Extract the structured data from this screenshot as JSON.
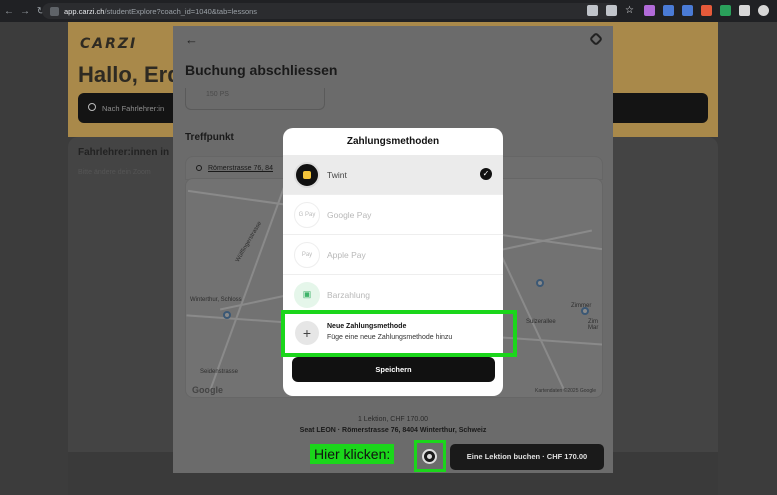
{
  "browser": {
    "back_icon": "arrow-left-icon",
    "forward_icon": "arrow-right-icon",
    "reload_icon": "reload-icon",
    "url_host": "app.carzi.ch",
    "url_path": "/studentExplore?coach_id=1040&tab=lessons",
    "extensions": [
      "#c0c4ca",
      "#c0c4ca",
      "#e8eaed",
      "#b26bd9",
      "#4a7bd6",
      "#4a7bd6",
      "#e65a3a",
      "#2aa15b",
      "#d7d7d7",
      "#d7d7d7"
    ]
  },
  "page": {
    "logo": "CARZI",
    "greeting": "Hallo, Erd",
    "search_placeholder": "Nach Fahrlehrer:in",
    "section_title": "Fahrlehrer:innen in",
    "section_text": "Bitte ändere dein Zoom"
  },
  "booking": {
    "title": "Buchung abschliessen",
    "field_value": "150 PS",
    "meeting_point_label": "Treffpunkt",
    "address_short": "Römerstrasse 76, 84",
    "summary_line1": "1 Lektion, CHF 170.00",
    "summary_line2": "Seat LEON · Römerstrasse 76, 8404 Winterthur, Schweiz",
    "book_button": "Eine Lektion buchen · CHF 170.00"
  },
  "map": {
    "labels": [
      "Zimmer",
      "Zim Mar",
      "Sulzerallee",
      "Seidenstrasse",
      "Wülflingerstrasse",
      "Winterthur, Schloss"
    ],
    "logo": "Google",
    "credit": "Kartendaten ©2025 Google"
  },
  "modal": {
    "title": "Zahlungsmethoden",
    "methods": [
      {
        "label": "Twint",
        "icon": "twint-icon",
        "selected": true
      },
      {
        "label": "Google Pay",
        "icon": "google-pay-icon",
        "selected": false
      },
      {
        "label": "Apple Pay",
        "icon": "apple-pay-icon",
        "selected": false
      },
      {
        "label": "Barzahlung",
        "icon": "cash-icon",
        "selected": false
      }
    ],
    "add_title": "Neue Zahlungsmethode",
    "add_subtitle": "Füge eine neue Zahlungsmethode hinzu",
    "save_button": "Speichern"
  },
  "tutorial": {
    "click_here": "Hier klicken:",
    "highlight_color": "#1bd61b"
  }
}
